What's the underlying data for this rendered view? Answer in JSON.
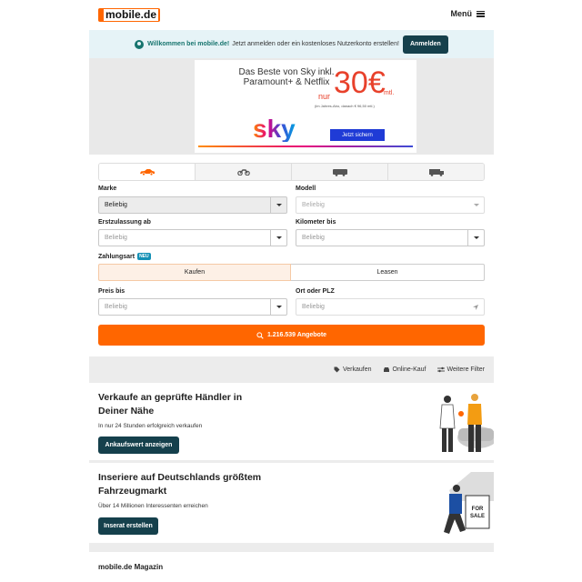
{
  "header": {
    "logo_text": "mobile.de",
    "menu_label": "Menü"
  },
  "welcome": {
    "bold": "Willkommen bei mobile.de!",
    "text": "Jetzt anmelden oder ein kostenloses Nutzerkonto erstellen!",
    "button": "Anmelden"
  },
  "ad": {
    "headline": "Das Beste von Sky inkl. Paramount+ & Netflix",
    "nur": "nur",
    "price": "30€",
    "mtl": "mtl.",
    "fineprint": "(im Jahres-Abo, danach € 96,50 mtl.)",
    "brand": "sky",
    "cta": "Jetzt sichern"
  },
  "search": {
    "tabs": [
      "car-icon",
      "motorbike-icon",
      "camper-icon",
      "truck-icon"
    ],
    "marke_label": "Marke",
    "marke_value": "Beliebig",
    "modell_label": "Modell",
    "modell_value": "Beliebig",
    "ez_label": "Erstzulassung ab",
    "ez_placeholder": "Beliebig",
    "km_label": "Kilometer bis",
    "km_placeholder": "Beliebig",
    "zahlungsart_label": "Zahlungsart",
    "new_badge": "NEU",
    "kaufen": "Kaufen",
    "leasen": "Leasen",
    "preis_label": "Preis bis",
    "preis_placeholder": "Beliebig",
    "ort_label": "Ort oder PLZ",
    "ort_placeholder": "Beliebig",
    "submit": "1.216.539 Angebote"
  },
  "filters": {
    "verkaufen": "Verkaufen",
    "online_kauf": "Online-Kauf",
    "weitere": "Weitere Filter"
  },
  "promo1": {
    "title": "Verkaufe an geprüfte Händler in Deiner Nähe",
    "text": "In nur 24 Stunden erfolgreich verkaufen",
    "button": "Ankaufswert anzeigen"
  },
  "promo2": {
    "title": "Inseriere auf Deutschlands größtem Fahrzeugmarkt",
    "text": "Über 14 Millionen Interessenten erreichen",
    "button": "Inserat erstellen",
    "sign": "FOR SALE"
  },
  "magazin": {
    "title": "mobile.de Magazin"
  },
  "colors": {
    "brand_orange": "#ff6600",
    "dark_teal": "#15404c",
    "welcome_bg": "#e6f3f7"
  }
}
